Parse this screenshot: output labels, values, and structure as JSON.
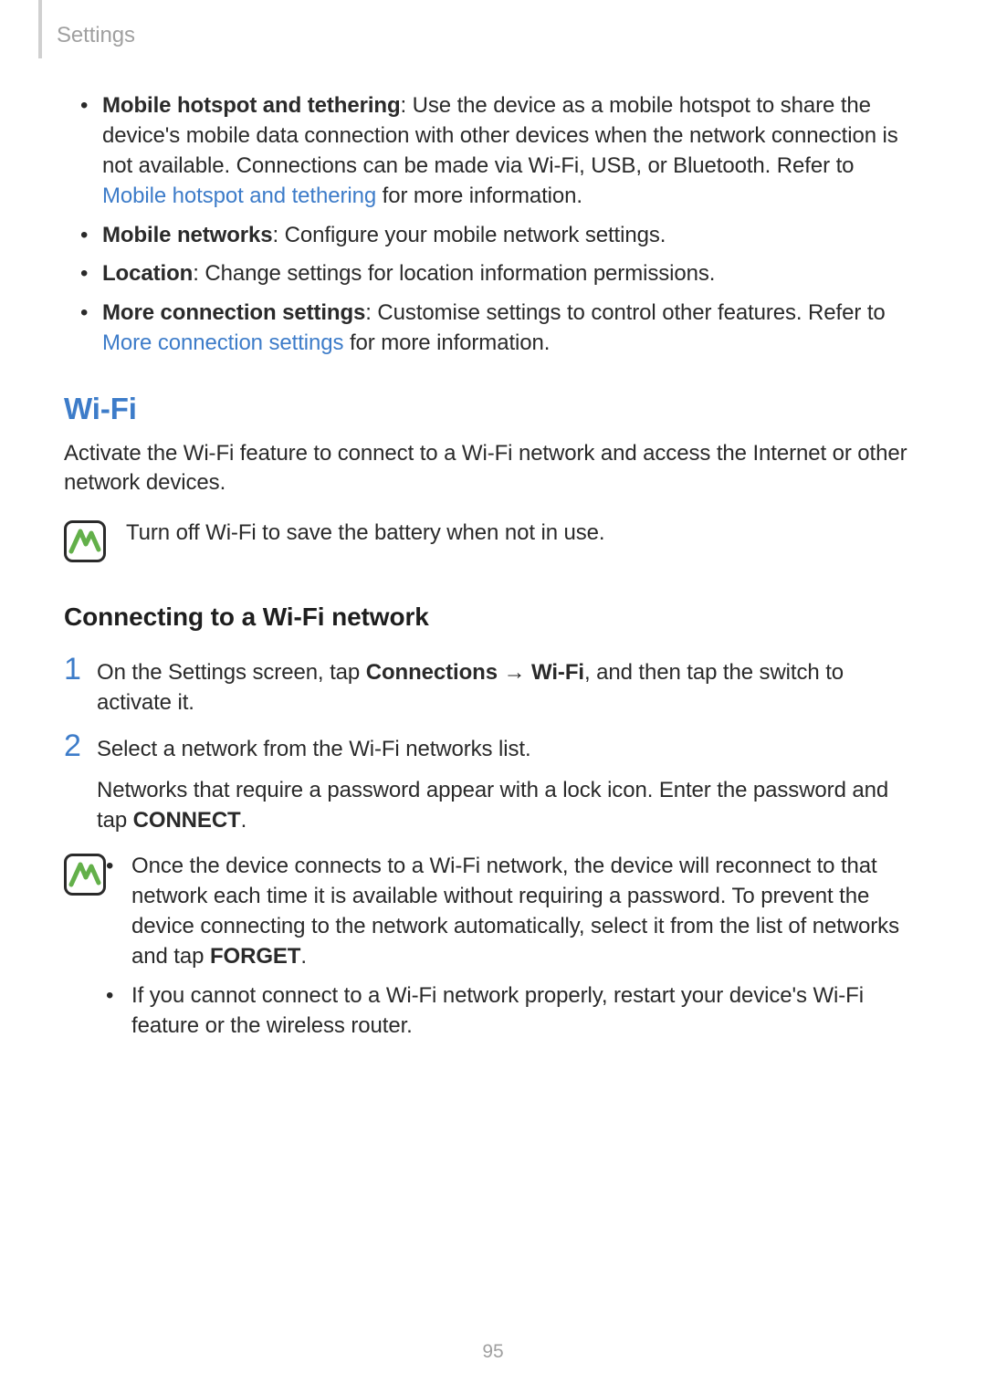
{
  "header": {
    "section": "Settings"
  },
  "bullets": {
    "item1": {
      "title": "Mobile hotspot and tethering",
      "text_before_link": ": Use the device as a mobile hotspot to share the device's mobile data connection with other devices when the network connection is not available. Connections can be made via Wi-Fi, USB, or Bluetooth. Refer to ",
      "link": "Mobile hotspot and tethering",
      "text_after_link": " for more information."
    },
    "item2": {
      "title": "Mobile networks",
      "text": ": Configure your mobile network settings."
    },
    "item3": {
      "title": "Location",
      "text": ": Change settings for location information permissions."
    },
    "item4": {
      "title": "More connection settings",
      "text_before_link": ": Customise settings to control other features. Refer to ",
      "link": "More connection settings",
      "text_after_link": " for more information."
    }
  },
  "wifi": {
    "heading": "Wi-Fi",
    "intro": "Activate the Wi-Fi feature to connect to a Wi-Fi network and access the Internet or other network devices.",
    "tip": "Turn off Wi-Fi to save the battery when not in use.",
    "connect_heading": "Connecting to a Wi-Fi network",
    "step1": {
      "num": "1",
      "pre": "On the Settings screen, tap ",
      "b1": "Connections",
      "arrow": " → ",
      "b2": "Wi-Fi",
      "post": ", and then tap the switch to activate it."
    },
    "step2": {
      "num": "2",
      "line1": "Select a network from the Wi-Fi networks list.",
      "line2a": "Networks that require a password appear with a lock icon. Enter the password and tap ",
      "connect": "CONNECT",
      "line2b": "."
    },
    "notes": {
      "n1a": "Once the device connects to a Wi-Fi network, the device will reconnect to that network each time it is available without requiring a password. To prevent the device connecting to the network automatically, select it from the list of networks and tap ",
      "forget": "FORGET",
      "n1b": ".",
      "n2": "If you cannot connect to a Wi-Fi network properly, restart your device's Wi-Fi feature or the wireless router."
    }
  },
  "page_number": "95"
}
